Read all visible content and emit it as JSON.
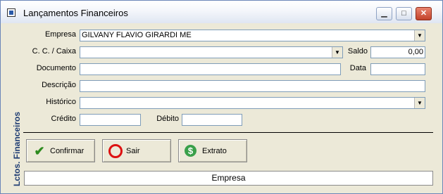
{
  "window": {
    "title": "Lançamentos Financeiros",
    "icon": "app-window-icon",
    "minimize_icon": "minimize-icon",
    "maximize_icon": "maximize-icon",
    "close_icon": "close-icon",
    "minimize_glyph": "▁",
    "maximize_glyph": "□",
    "close_glyph": "✕"
  },
  "sidebar": {
    "label": "Lctos. Financeiros"
  },
  "form": {
    "empresa_label": "Empresa",
    "empresa_value": "GILVANY FLAVIO GIRARDI ME",
    "cc_caixa_label": "C. C. / Caixa",
    "cc_caixa_value": "",
    "saldo_label": "Saldo",
    "saldo_value": "0,00",
    "documento_label": "Documento",
    "documento_value": "",
    "data_label": "Data",
    "data_value": "",
    "descricao_label": "Descrição",
    "descricao_value": "",
    "historico_label": "Histórico",
    "historico_value": "",
    "credito_label": "Crédito",
    "credito_value": "",
    "debito_label": "Débito",
    "debito_value": "",
    "combo_arrow": "▼"
  },
  "buttons": {
    "confirmar_label": "Confirmar",
    "confirmar_icon": "check-icon",
    "sair_label": "Sair",
    "sair_icon": "stop-icon",
    "extrato_label": "Extrato",
    "extrato_icon": "dollar-icon",
    "check_glyph": "✔",
    "stop_glyph": "⊘",
    "dollar_glyph": "$"
  },
  "status": {
    "text": "Empresa"
  },
  "colors": {
    "title_text": "#000000",
    "sidebar_text": "#1f3d73",
    "check_icon": "#2e8b1f",
    "stop_icon": "#dd1111",
    "dollar_icon": "#3aa04a"
  }
}
